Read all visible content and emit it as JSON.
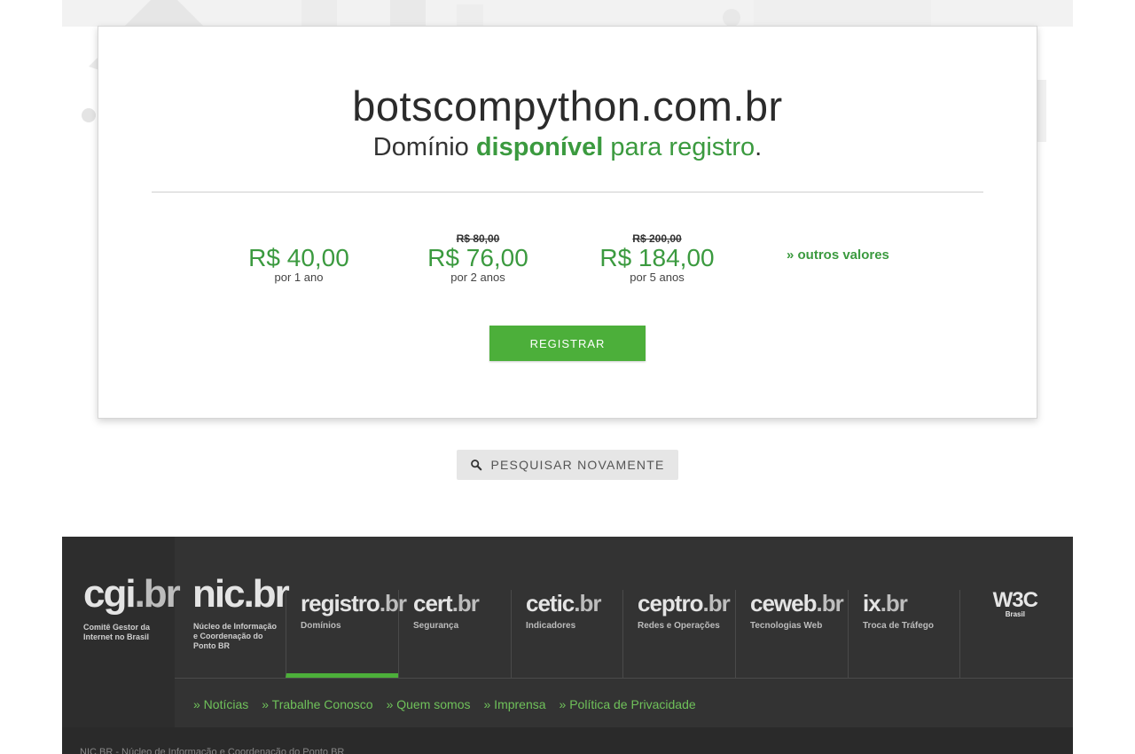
{
  "result": {
    "domain": "botscompython.com.br",
    "availability_prefix": "Domínio ",
    "availability_word": "disponível",
    "availability_suffix": " para registro",
    "availability_end": "."
  },
  "prices": [
    {
      "old": "",
      "amount": "R$ 40,00",
      "period": "por 1 ano"
    },
    {
      "old": "R$ 80,00",
      "amount": "R$ 76,00",
      "period": "por 2 anos"
    },
    {
      "old": "R$ 200,00",
      "amount": "R$ 184,00",
      "period": "por 5 anos"
    }
  ],
  "other_values": "» outros valores",
  "register_label": "REGISTRAR",
  "search_again_label": "PESQUISAR NOVAMENTE",
  "footer": {
    "cgi": {
      "logo": "cgi",
      "logo_suffix": ".br",
      "caption": "Comitê Gestor da Internet no Brasil"
    },
    "nic": {
      "logo": "nic",
      "logo_suffix": ".br",
      "caption": "Núcleo de Informação e Coordenação do Ponto BR"
    },
    "tiles": [
      {
        "logo": "registro",
        "suffix": ".br",
        "caption": "Domínios"
      },
      {
        "logo": "cert",
        "suffix": ".br",
        "caption": "Segurança"
      },
      {
        "logo": "cetic",
        "suffix": ".br",
        "caption": "Indicadores"
      },
      {
        "logo": "ceptro",
        "suffix": ".br",
        "caption": "Redes e Operações"
      },
      {
        "logo": "ceweb",
        "suffix": ".br",
        "caption": "Tecnologias Web"
      },
      {
        "logo": "ix",
        "suffix": ".br",
        "caption": "Troca de Tráfego"
      }
    ],
    "w3c": {
      "logo": "W3C",
      "caption": "Brasil"
    },
    "links": [
      "» Notícias",
      "» Trabalhe Conosco",
      "» Quem somos",
      "» Imprensa",
      "» Política de Privacidade"
    ],
    "bottom_text": "NIC.BR - Núcleo de Informação e Coordenação do Ponto BR"
  },
  "colors": {
    "accent": "#3b9a3f",
    "button": "#4caf3a",
    "footer": "#333333"
  },
  "icons": {
    "search": "search-icon"
  }
}
